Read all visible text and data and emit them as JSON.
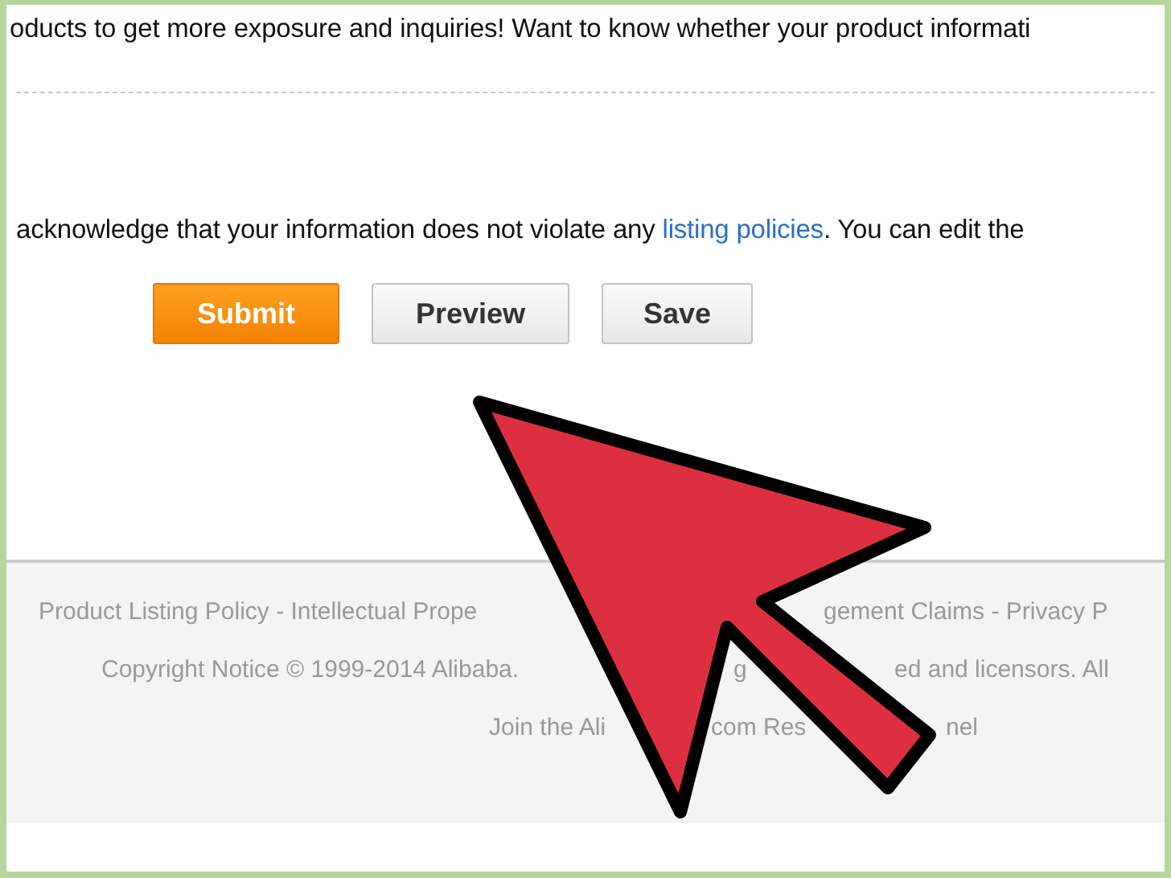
{
  "intro_text": "oducts to get more exposure and inquiries! Want to know whether your product informati",
  "notice": {
    "before": "acknowledge that your information does not violate any ",
    "link": "listing policies",
    "after": ". You can edit the"
  },
  "buttons": [
    {
      "label": "Submit",
      "kind": "primary"
    },
    {
      "label": "Preview",
      "kind": "secondary"
    },
    {
      "label": "Save",
      "kind": "secondary"
    }
  ],
  "footer_lines": [
    [
      "Product Listing Policy - Intellectual Prope",
      "gement Claims - Privacy P"
    ],
    [
      "Copyright Notice © 1999-2014 Alibaba.",
      "g",
      "ed and licensors. All"
    ],
    [
      "Join the Ali",
      "com Res",
      "nel"
    ]
  ]
}
